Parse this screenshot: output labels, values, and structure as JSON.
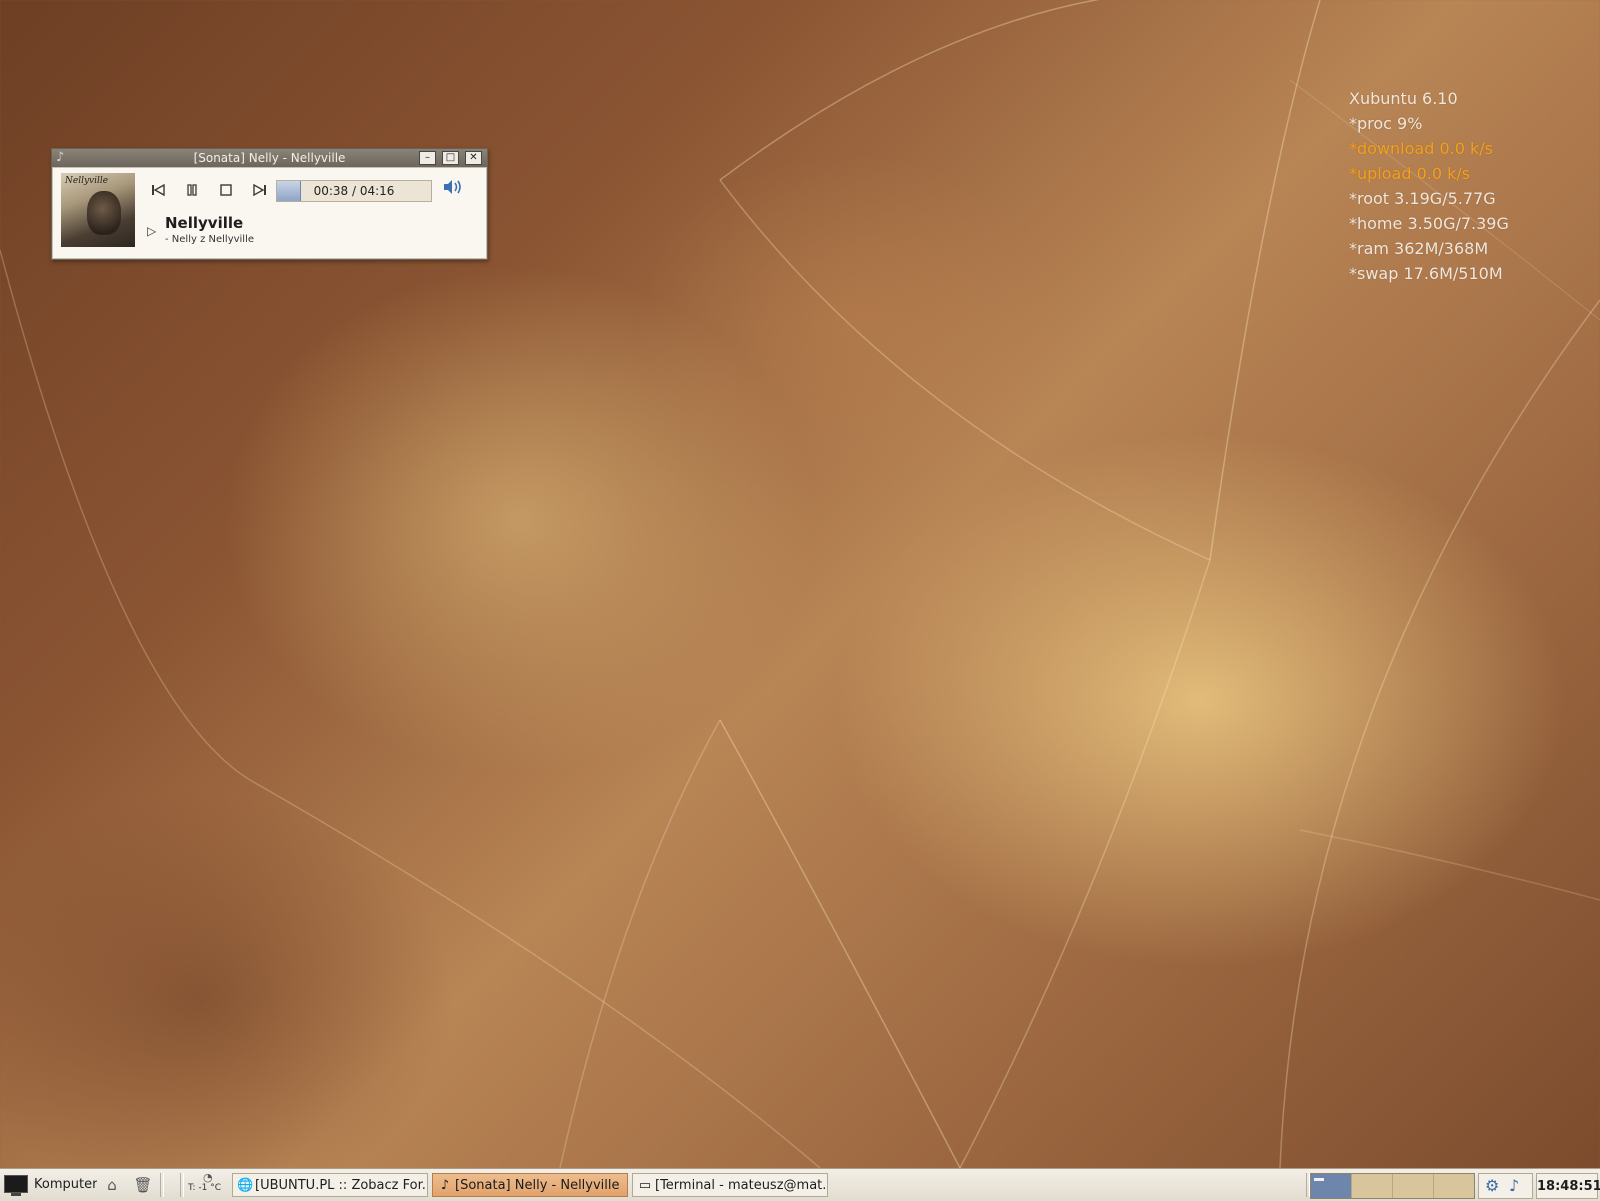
{
  "conky": {
    "lines": [
      "Xubuntu 6.10",
      "*proc 9%",
      "*download 0.0 k/s",
      "*upload 0.0 k/s",
      "*root 3.19G/5.77G",
      "*home 3.50G/7.39G",
      "*ram 362M/368M",
      "*swap 17.6M/510M"
    ],
    "highlight_color": "#f3a21e",
    "text_color": "#f1e7dc"
  },
  "player": {
    "window_title": "[Sonata] Nelly - Nellyville",
    "app_icon": "music-note-icon",
    "album_cover_text": "Nellyville",
    "time_display": "00:38 / 04:16",
    "progress_fraction": 0.15,
    "song_title": "Nellyville",
    "song_subtitle": "- Nelly z Nellyville",
    "controls": [
      "previous-icon",
      "pause-icon",
      "stop-icon",
      "next-icon",
      "volume-icon"
    ]
  },
  "taskbar": {
    "start_label": "Komputer",
    "temperature": "T: -1 °C",
    "tasks": [
      {
        "label": "[UBUNTU.PL :: Zobacz For...",
        "icon": "globe-icon",
        "active": false
      },
      {
        "label": "[Sonata] Nelly - Nellyville",
        "icon": "music-note-icon",
        "active": true
      },
      {
        "label": "[Terminal - mateusz@mat...",
        "icon": "terminal-icon",
        "active": false
      }
    ],
    "workspaces": 4,
    "active_workspace": 1,
    "clock": "18:48:51",
    "accent_color": "#e2a26c"
  }
}
